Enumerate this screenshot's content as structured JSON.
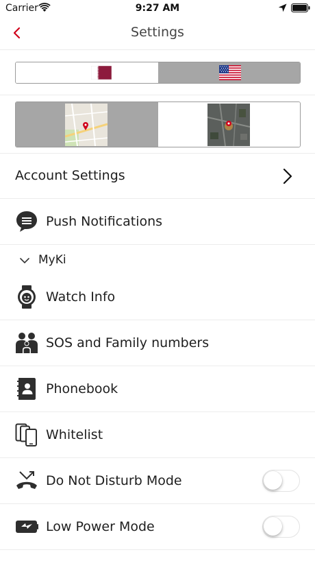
{
  "status_bar": {
    "carrier": "Carrier",
    "time": "9:27 AM"
  },
  "nav": {
    "title": "Settings"
  },
  "language_selector": {
    "options": [
      "qatar-flag",
      "us-flag"
    ],
    "selected": 1
  },
  "map_selector": {
    "options": [
      "street-map",
      "satellite-map"
    ],
    "selected": 0
  },
  "account_settings": {
    "label": "Account Settings"
  },
  "push_notifications": {
    "label": "Push Notifications",
    "icon": "chat-bubble-icon"
  },
  "myki_section": {
    "label": "MyKi"
  },
  "items": [
    {
      "label": "Watch Info",
      "icon": "watch-icon"
    },
    {
      "label": "SOS and Family numbers",
      "icon": "family-icon"
    },
    {
      "label": "Phonebook",
      "icon": "phonebook-icon"
    },
    {
      "label": "Whitelist",
      "icon": "devices-icon"
    }
  ],
  "toggles": [
    {
      "label": "Do Not Disturb Mode",
      "icon": "phone-hangup-icon",
      "on": false
    },
    {
      "label": "Low Power Mode",
      "icon": "battery-charge-icon",
      "on": false
    }
  ],
  "colors": {
    "accent": "#d0021b",
    "segment_selected": "#a6a6a6",
    "divider": "#ececec"
  }
}
